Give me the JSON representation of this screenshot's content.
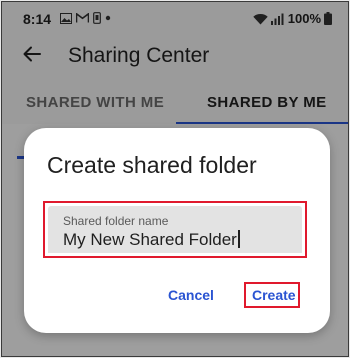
{
  "status_bar": {
    "time": "8:14",
    "left_icons": [
      "image-icon",
      "gmail-icon",
      "phone-storage-icon",
      "dot-icon"
    ],
    "battery": "100%"
  },
  "app_bar": {
    "title": "Sharing Center"
  },
  "tabs": [
    {
      "label": "SHARED WITH ME",
      "selected": false
    },
    {
      "label": "SHARED BY ME",
      "selected": true
    }
  ],
  "dialog": {
    "title": "Create shared folder",
    "field": {
      "label": "Shared folder name",
      "value": "My New Shared Folder"
    },
    "cancel_label": "Cancel",
    "create_label": "Create"
  },
  "colors": {
    "accent": "#2a54d2",
    "highlight": "#e0192d"
  }
}
